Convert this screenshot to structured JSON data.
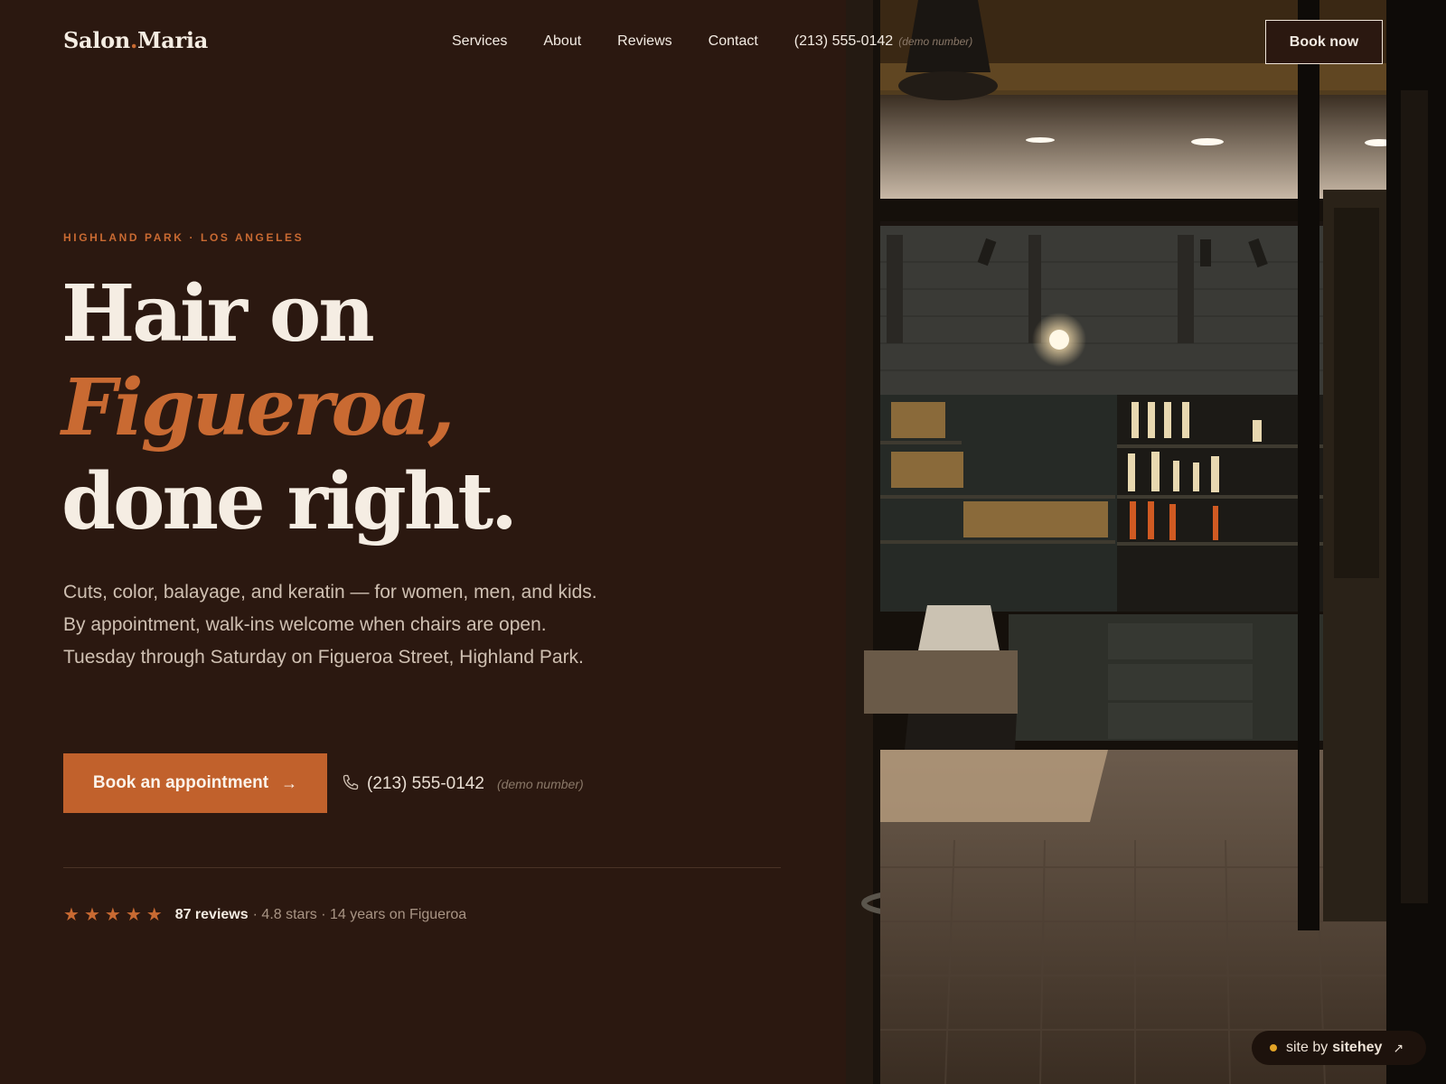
{
  "brand": {
    "name_first": "Salon",
    "dot": ".",
    "name_second": "Maria"
  },
  "nav": {
    "items": [
      "Services",
      "About",
      "Reviews",
      "Contact"
    ],
    "phone": "(213) 555-0142",
    "phone_note": "(demo number)",
    "cta": "Book now"
  },
  "hero": {
    "eyebrow": "HIGHLAND PARK · LOS ANGELES",
    "headline_line1": "Hair on",
    "headline_accent": "Figueroa,",
    "headline_line3": "done right.",
    "lede": "Cuts, color, balayage, and keratin — for women, men, and kids. By appointment, walk-ins welcome when chairs are open. Tuesday through Saturday on Figueroa Street, Highland Park.",
    "cta": "Book an appointment",
    "cta_arrow": "→",
    "phone": "(213) 555-0142",
    "phone_note": "(demo number)"
  },
  "rating": {
    "stars": 5,
    "reviews": "87 reviews",
    "meta": "· 4.8 stars · 14 years on Figueroa"
  },
  "badge": {
    "prefix": "site by",
    "name": "sitehey",
    "icon": "↗"
  },
  "colors": {
    "background": "#2b1810",
    "accent": "#c96a32",
    "text": "#f3ebe2"
  },
  "icons": [
    "phone-icon",
    "star-icon",
    "arrow-right-icon",
    "external-link-icon"
  ]
}
